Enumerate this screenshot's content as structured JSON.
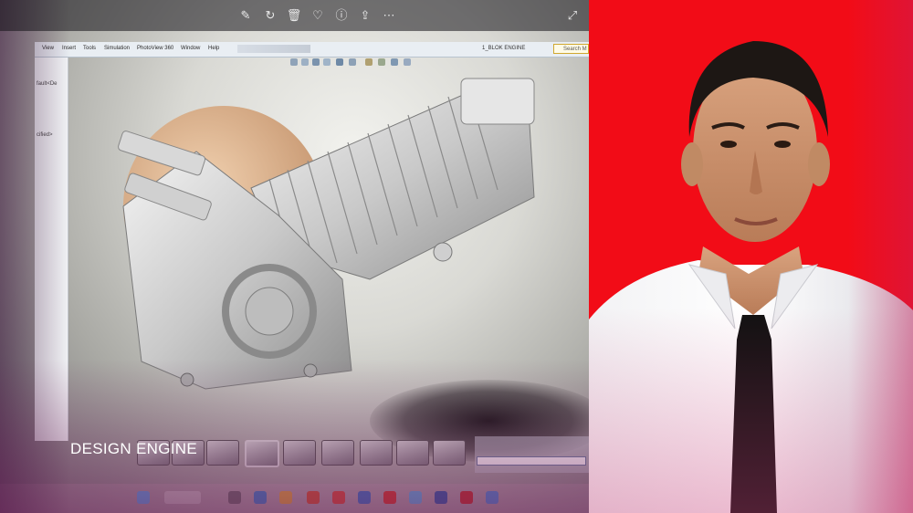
{
  "viewer_toolbar": {
    "icons": [
      "edit-icon",
      "rotate-icon",
      "delete-icon",
      "favorite-icon",
      "info-icon",
      "share-icon",
      "more-icon",
      "expand-icon"
    ]
  },
  "cad_app": {
    "menu": [
      "View",
      "Insert",
      "Tools",
      "Simulation",
      "PhotoView 360",
      "Window",
      "Help"
    ],
    "document_title": "1_BLOK ENGINE",
    "search_placeholder": "Search M",
    "tree_lines": [
      "fault<De",
      "cified>"
    ]
  },
  "caption": "DESIGN ENGINE",
  "colors": {
    "portrait_background": "#f20c17",
    "gradient_start": "#3b1e3e",
    "gradient_end": "#e0573f"
  }
}
